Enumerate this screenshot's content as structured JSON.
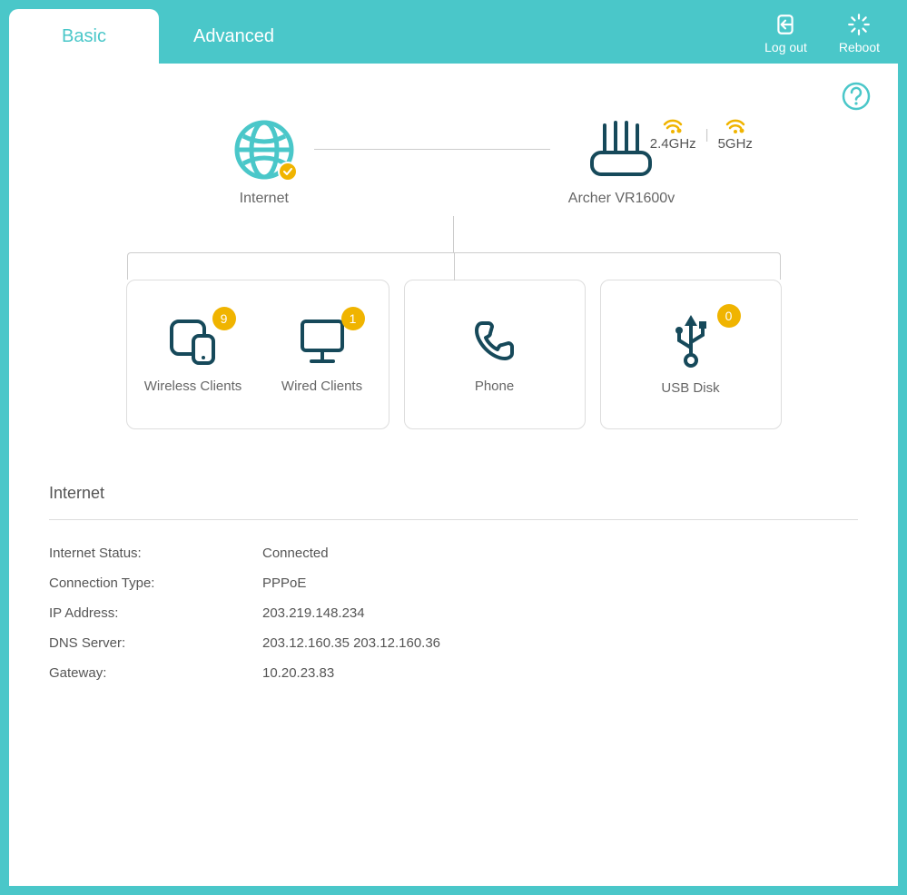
{
  "tabs": {
    "basic": "Basic",
    "advanced": "Advanced"
  },
  "actions": {
    "logout": "Log out",
    "reboot": "Reboot"
  },
  "topo": {
    "internet_label": "Internet",
    "router_label": "Archer VR1600v",
    "wifi24": "2.4GHz",
    "wifi5": "5GHz"
  },
  "cards": {
    "wireless": {
      "label": "Wireless Clients",
      "count": "9"
    },
    "wired": {
      "label": "Wired Clients",
      "count": "1"
    },
    "phone": {
      "label": "Phone"
    },
    "usb": {
      "label": "USB Disk",
      "count": "0"
    }
  },
  "internet": {
    "heading": "Internet",
    "status_k": "Internet Status:",
    "status_v": "Connected",
    "conn_k": "Connection Type:",
    "conn_v": "PPPoE",
    "ip_k": "IP Address:",
    "ip_v": "203.219.148.234",
    "dns_k": "DNS Server:",
    "dns_v": "203.12.160.35 203.12.160.36",
    "gw_k": "Gateway:",
    "gw_v": "10.20.23.83"
  }
}
